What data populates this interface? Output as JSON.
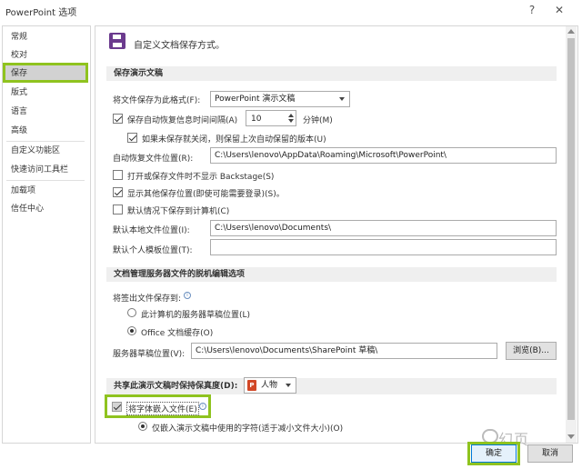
{
  "window": {
    "title": "PowerPoint 选项",
    "help_glyph": "?",
    "close_glyph": "✕"
  },
  "sidebar": {
    "items": [
      {
        "label": "常规"
      },
      {
        "label": "校对"
      },
      {
        "label": "保存",
        "active": true
      },
      {
        "label": "版式"
      },
      {
        "label": "语言"
      },
      {
        "label": "高级"
      },
      {
        "label": "自定义功能区"
      },
      {
        "label": "快速访问工具栏"
      },
      {
        "label": "加载项"
      },
      {
        "label": "信任中心"
      }
    ]
  },
  "header": {
    "icon": "save-icon",
    "text": "自定义文档保存方式。"
  },
  "save_section": {
    "title": "保存演示文稿",
    "format_label": "将文件保存为此格式(F):",
    "format_value": "PowerPoint 演示文稿",
    "autorecover_label": "保存自动恢复信息时间间隔(A)",
    "autorecover_checked": true,
    "autorecover_minutes": "10",
    "minutes_label": "分钟(M)",
    "keep_last_label": "如果未保存就关闭，则保留上次自动保留的版本(U)",
    "keep_last_checked": true,
    "autorecover_location_label": "自动恢复文件位置(R):",
    "autorecover_location_value": "C:\\Users\\lenovo\\AppData\\Roaming\\Microsoft\\PowerPoint\\",
    "no_backstage_label": "打开或保存文件时不显示 Backstage(S)",
    "no_backstage_checked": false,
    "show_other_label": "显示其他保存位置(即使可能需要登录)(S)。",
    "show_other_checked": true,
    "default_computer_label": "默认情况下保存到计算机(C)",
    "default_computer_checked": false,
    "default_local_label": "默认本地文件位置(I):",
    "default_local_value": "C:\\Users\\lenovo\\Documents\\",
    "personal_templates_label": "默认个人模板位置(T):",
    "personal_templates_value": ""
  },
  "offline_section": {
    "title": "文档管理服务器文件的脱机编辑选项",
    "checkout_label": "将签出文件保存到:",
    "option_server": "此计算机的服务器草稿位置(L)",
    "option_server_selected": false,
    "option_office": "Office 文档缓存(O)",
    "option_office_selected": true,
    "drafts_label": "服务器草稿位置(V):",
    "drafts_value": "C:\\Users\\lenovo\\Documents\\SharePoint 草稿\\",
    "browse_label": "浏览(B)..."
  },
  "fidelity_section": {
    "title": "共享此演示文稿时保持保真度(D):",
    "presentation_value": "人物",
    "embed_fonts_label": "将字体嵌入文件(E)",
    "embed_fonts_checked": true,
    "embed_used_label": "仅嵌入演示文稿中使用的字符(适于减小文件大小)(O)",
    "embed_used_selected": true
  },
  "footer": {
    "ok_label": "确定",
    "cancel_label": "取消"
  },
  "watermark": {
    "text": "幻页"
  },
  "colors": {
    "highlight": "#8fc31f",
    "save_icon": "#6b3a8e",
    "ppt_icon": "#d24726"
  }
}
